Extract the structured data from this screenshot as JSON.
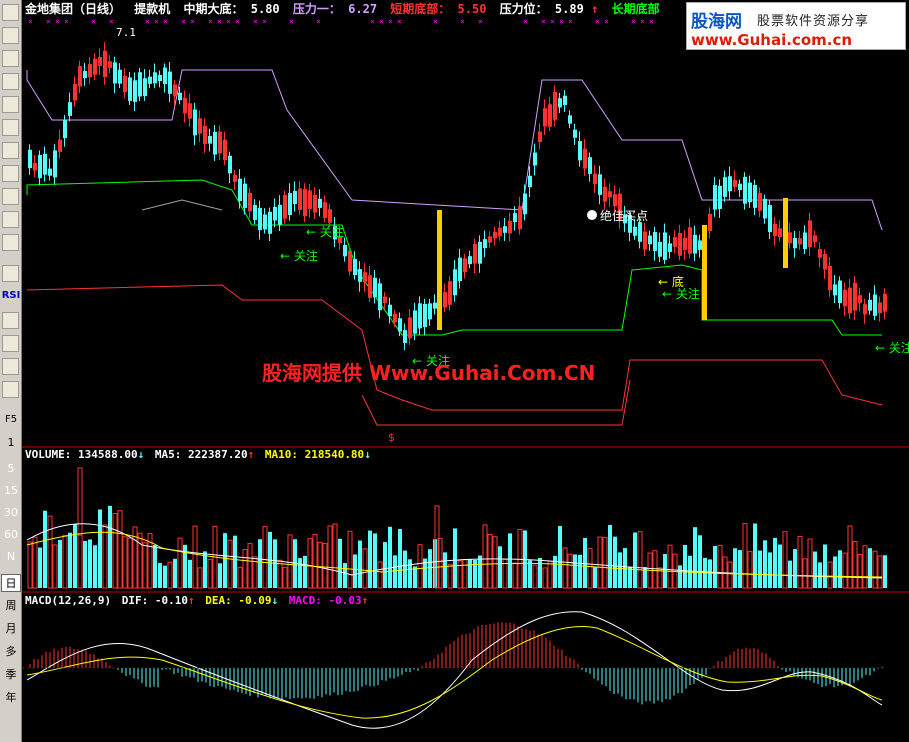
{
  "header": {
    "stock": "金地集团（日线）",
    "indicator": "提款机",
    "mid_bottom_label": "中期大底：",
    "mid_bottom_value": "5.80",
    "pressure1_label": "压力一：",
    "pressure1_value": "6.27",
    "short_bottom_label": "短期底部：",
    "short_bottom_value": "5.50",
    "pressure_label": "压力位：",
    "pressure_value": "5.89",
    "long_bottom_label": "长期底部"
  },
  "logo": {
    "brand": "股海网",
    "tagline": "股票软件资源分享",
    "url": "www.Guhai.com.cn"
  },
  "watermark": "股海网提供 Www.Guhai.Com.CN",
  "main_annotations": {
    "high_price": "7.1",
    "best_buy": "绝佳买点",
    "watch": "关注",
    "watch_arrow": "← 关注",
    "bottom_arrow": "← 底",
    "dollar_marker": "$"
  },
  "volume_header": {
    "label": "VOLUME:",
    "value": "134588.00",
    "ma5_label": "MA5:",
    "ma5_value": "222387.20",
    "ma10_label": "MA10:",
    "ma10_value": "218540.80"
  },
  "volume_axis": [
    "5",
    "15",
    "30",
    "60",
    "N"
  ],
  "macd_header": {
    "label": "MACD(12,26,9)",
    "dif_label": "DIF:",
    "dif_value": "-0.10",
    "dea_label": "DEA:",
    "dea_value": "-0.09",
    "macd_label": "MACD:",
    "macd_value": "-0.03"
  },
  "toolbar": {
    "rsi": "RSI",
    "f5": "F5",
    "n1": "1",
    "day": "日",
    "week": "周",
    "month": "月",
    "multi": "多",
    "season": "季",
    "year": "年"
  },
  "colors": {
    "up": "#ff3232",
    "down": "#54fcfc",
    "ma5": "#ffffff",
    "ma10": "#ffff00",
    "macd_label": "#ff00ff",
    "green": "#00ff00",
    "purple": "#d2a0ff"
  }
}
